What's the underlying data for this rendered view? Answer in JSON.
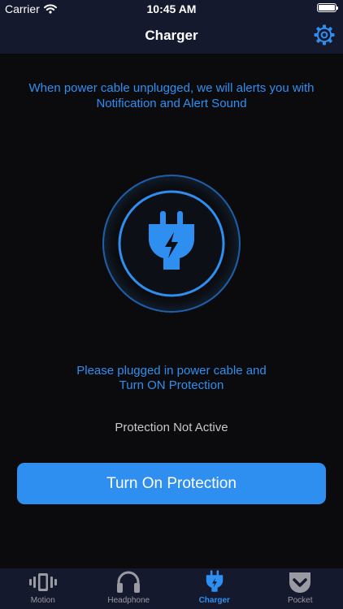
{
  "status_bar": {
    "carrier": "Carrier",
    "time": "10:45 AM"
  },
  "header": {
    "title": "Charger"
  },
  "main": {
    "info": "When power cable unplugged, we will alerts you with Notification and Alert Sound",
    "plug_prompt_line1": "Please plugged in power cable and",
    "plug_prompt_line2": "Turn ON Protection",
    "status": "Protection Not Active",
    "button_label": "Turn On Protection",
    "graphic_icon": "charger-plug-icon"
  },
  "tabbar": {
    "tabs": [
      {
        "label": "Motion",
        "icon": "vibration-icon",
        "active": false
      },
      {
        "label": "Headphone",
        "icon": "headphone-icon",
        "active": false
      },
      {
        "label": "Charger",
        "icon": "charger-plug-icon",
        "active": true
      },
      {
        "label": "Pocket",
        "icon": "pocket-icon",
        "active": false
      }
    ]
  },
  "colors": {
    "accent": "#2f8ff0",
    "background": "#0b0b0e",
    "bar": "#15192e",
    "inactive": "#9a9aa2",
    "status_text": "#c8c8cc"
  }
}
